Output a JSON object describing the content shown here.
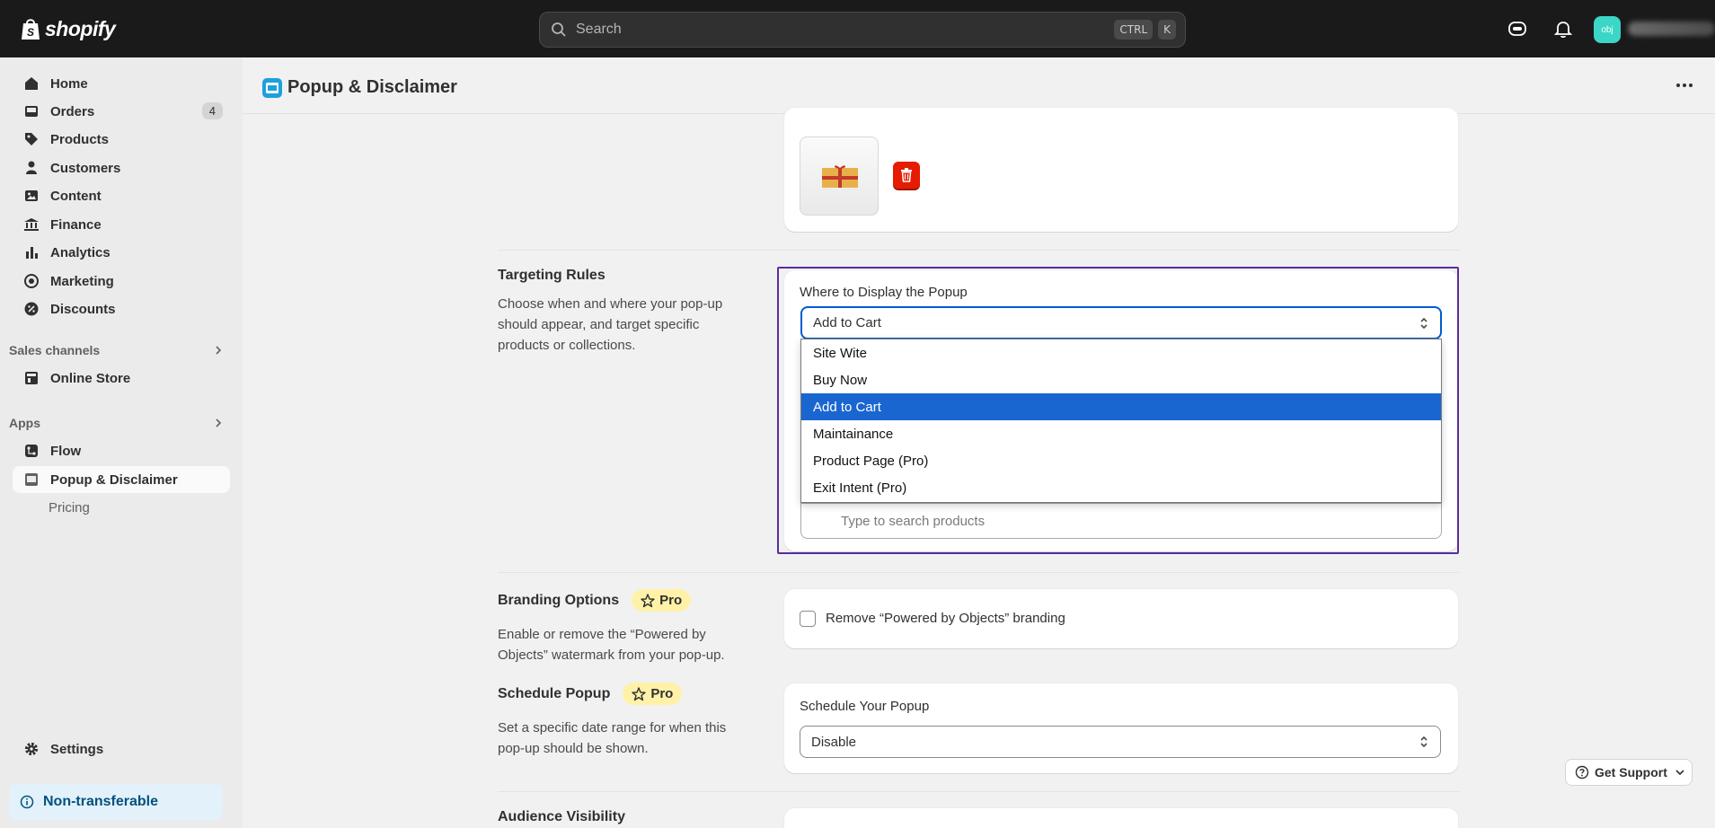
{
  "topbar": {
    "logo_text": "shopify",
    "search_placeholder": "Search",
    "shortcut_keys": [
      "CTRL",
      "K"
    ],
    "avatar_initials": "obj"
  },
  "sidebar": {
    "items": [
      {
        "label": "Home",
        "icon": "home-icon"
      },
      {
        "label": "Orders",
        "icon": "orders-icon",
        "badge": "4"
      },
      {
        "label": "Products",
        "icon": "tag-icon"
      },
      {
        "label": "Customers",
        "icon": "person-icon"
      },
      {
        "label": "Content",
        "icon": "content-icon"
      },
      {
        "label": "Finance",
        "icon": "bank-icon"
      },
      {
        "label": "Analytics",
        "icon": "chart-icon"
      },
      {
        "label": "Marketing",
        "icon": "target-icon"
      },
      {
        "label": "Discounts",
        "icon": "discount-icon"
      }
    ],
    "sales_channels_label": "Sales channels",
    "online_store_label": "Online Store",
    "apps_label": "Apps",
    "flow_label": "Flow",
    "popup_app_label": "Popup & Disclaimer",
    "pricing_label": "Pricing",
    "settings_label": "Settings",
    "non_transferable_label": "Non-transferable"
  },
  "page": {
    "title": "Popup & Disclaimer"
  },
  "targeting": {
    "title": "Targeting Rules",
    "description": "Choose when and where your pop-up should appear, and target specific products or collections.",
    "field_label": "Where to Display the Popup",
    "selected_value": "Add to Cart",
    "options": [
      "Site Wite",
      "Buy Now",
      "Add to Cart",
      "Maintainance",
      "Product Page (Pro)",
      "Exit Intent (Pro)"
    ],
    "selected_index": 2,
    "product_search_placeholder": "Type to search products"
  },
  "branding": {
    "title": "Branding Options",
    "pro_label": "Pro",
    "description": "Enable or remove the “Powered by Objects” watermark from your pop-up.",
    "checkbox_label": "Remove “Powered by Objects” branding",
    "checked": false
  },
  "schedule": {
    "title": "Schedule Popup",
    "pro_label": "Pro",
    "description": "Set a specific date range for when this pop-up should be shown.",
    "field_label": "Schedule Your Popup",
    "selected_value": "Disable"
  },
  "audience": {
    "title": "Audience Visibility"
  },
  "support_button_label": "Get Support",
  "colors": {
    "topbar": "#1a1a1a",
    "accent_blue": "#005bd3",
    "selected_option": "#1a66d1",
    "highlight_border": "#5b2c9c",
    "delete_red": "#e51c00",
    "pro_badge": "#fff2a8"
  }
}
